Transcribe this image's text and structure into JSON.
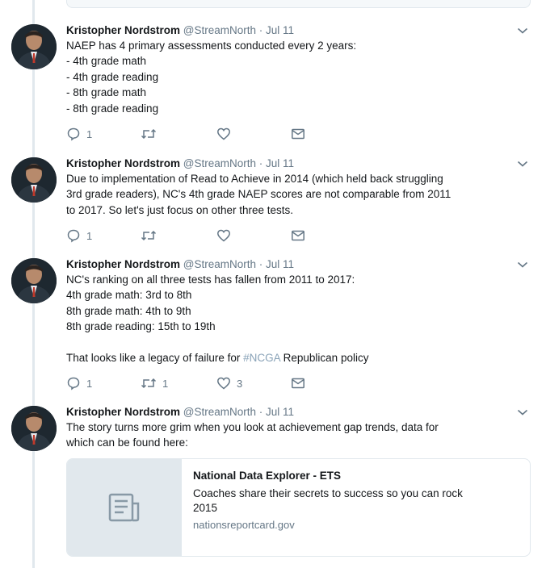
{
  "tweets": [
    {
      "author_name": "Kristopher Nordstrom",
      "handle": "@StreamNorth",
      "separator": "·",
      "date": "Jul 11",
      "text": "NAEP has 4 primary assessments conducted every 2 years:\n- 4th grade math\n- 4th grade reading\n- 8th grade math\n- 8th grade reading",
      "reply_count": "1",
      "retweet_count": "",
      "like_count": ""
    },
    {
      "author_name": "Kristopher Nordstrom",
      "handle": "@StreamNorth",
      "separator": "·",
      "date": "Jul 11",
      "text": "Due to implementation of Read to Achieve in 2014 (which held back struggling\n3rd grade readers), NC's 4th grade NAEP scores are not comparable from 2011\nto 2017. So let's just focus on other three tests.",
      "reply_count": "1",
      "retweet_count": "",
      "like_count": ""
    },
    {
      "author_name": "Kristopher Nordstrom",
      "handle": "@StreamNorth",
      "separator": "·",
      "date": "Jul 11",
      "text": "NC's ranking on all three tests has fallen from 2011 to 2017:\n4th grade math: 3rd to 8th\n8th grade math: 4th to 9th\n8th grade reading: 15th to 19th\n\nThat looks like a legacy of failure for ",
      "hashtag": "#NCGA",
      "text_after_hashtag": " Republican policy",
      "reply_count": "1",
      "retweet_count": "1",
      "like_count": "3"
    },
    {
      "author_name": "Kristopher Nordstrom",
      "handle": "@StreamNorth",
      "separator": "·",
      "date": "Jul 11",
      "text": "The story turns more grim when you look at achievement gap trends, data for\nwhich can be found here:"
    }
  ],
  "link_card": {
    "title": "National Data Explorer - ETS",
    "description": "Coaches share their secrets to success so you can rock\n2015",
    "domain": "nationsreportcard.gov",
    "thumbnail_icon": "document-icon"
  },
  "icons": {
    "reply": "reply-icon",
    "retweet": "retweet-icon",
    "like": "heart-icon",
    "dm": "envelope-icon",
    "more": "chevron-down-icon"
  },
  "colors": {
    "text_primary": "#14171a",
    "text_secondary": "#657786",
    "hashtag": "#8aa3b8",
    "border": "#e1e8ed"
  }
}
